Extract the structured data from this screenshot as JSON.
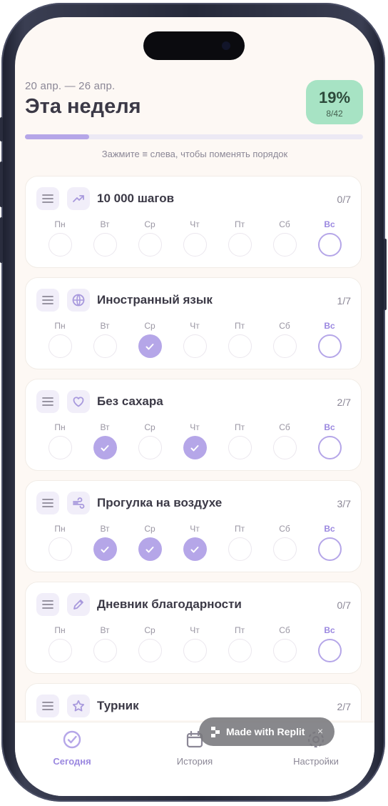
{
  "header": {
    "date_range": "20 апр. — 26 апр.",
    "title": "Эта неделя",
    "percent": "19%",
    "count": "8/42",
    "progress": 0.19
  },
  "hint": "Зажмите ≡ слева, чтобы поменять порядок",
  "day_labels": [
    "Пн",
    "Вт",
    "Ср",
    "Чт",
    "Пт",
    "Сб",
    "Вс"
  ],
  "today_index": 6,
  "habits": [
    {
      "name": "10 000 шагов",
      "count": "0/7",
      "icon": "trending-up-icon",
      "done": [
        false,
        false,
        false,
        false,
        false,
        false,
        false
      ]
    },
    {
      "name": "Иностранный язык",
      "count": "1/7",
      "icon": "globe-icon",
      "done": [
        false,
        false,
        true,
        false,
        false,
        false,
        false
      ]
    },
    {
      "name": "Без сахара",
      "count": "2/7",
      "icon": "heart-icon",
      "done": [
        false,
        true,
        false,
        true,
        false,
        false,
        false
      ]
    },
    {
      "name": "Прогулка на воздухе",
      "count": "3/7",
      "icon": "wind-icon",
      "done": [
        false,
        true,
        true,
        true,
        false,
        false,
        false
      ]
    },
    {
      "name": "Дневник благодарности",
      "count": "0/7",
      "icon": "pencil-icon",
      "done": [
        false,
        false,
        false,
        false,
        false,
        false,
        false
      ]
    },
    {
      "name": "Турник",
      "count": "2/7",
      "icon": "star-icon",
      "done": [
        false,
        false,
        false,
        false,
        false,
        false,
        false
      ]
    }
  ],
  "tabs": [
    {
      "label": "Сегодня",
      "icon": "check-circle-icon",
      "active": true
    },
    {
      "label": "История",
      "icon": "calendar-icon",
      "active": false
    },
    {
      "label": "Настройки",
      "icon": "settings-icon",
      "active": false
    }
  ],
  "badge": {
    "label": "Made with Replit",
    "close": "×"
  },
  "colors": {
    "accent": "#b5a6e8",
    "badge_bg": "#a7e3c4",
    "background": "#fdf8f4"
  }
}
